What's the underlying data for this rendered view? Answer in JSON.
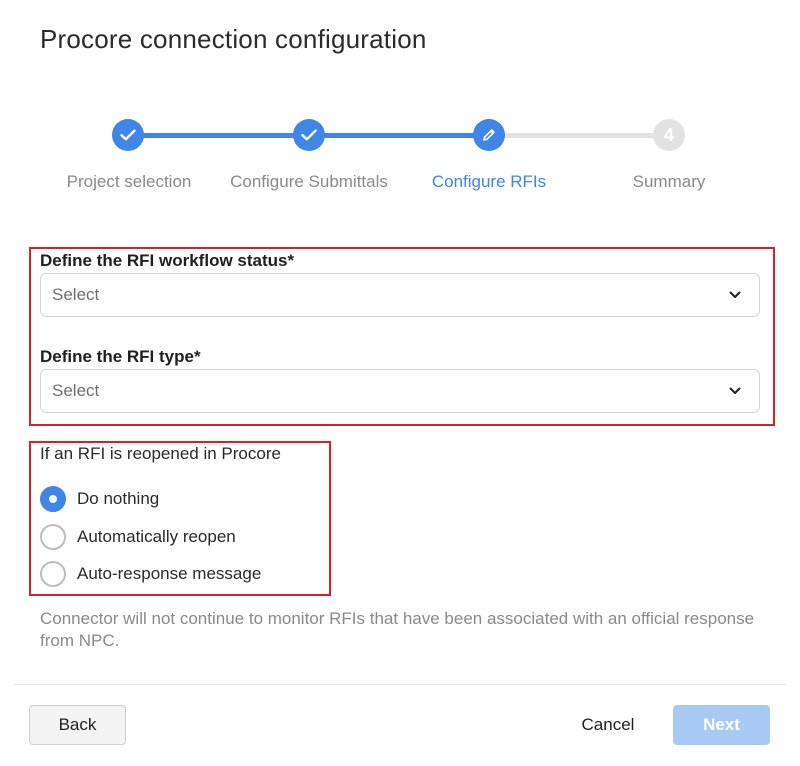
{
  "dialog": {
    "title": "Procore connection configuration"
  },
  "stepper": {
    "steps": [
      {
        "label": "Project selection",
        "state": "done",
        "icon": "check-icon"
      },
      {
        "label": "Configure Submittals",
        "state": "done",
        "icon": "check-icon"
      },
      {
        "label": "Configure RFIs",
        "state": "active",
        "icon": "pencil-icon"
      },
      {
        "label": "Summary",
        "state": "pending",
        "number": "4"
      }
    ]
  },
  "form": {
    "workflow_status": {
      "label": "Define the RFI workflow status*",
      "value": "Select"
    },
    "rfi_type": {
      "label": "Define the RFI type*",
      "value": "Select"
    },
    "reopen": {
      "label": "If an RFI is reopened in Procore",
      "options": [
        {
          "label": "Do nothing",
          "checked": true
        },
        {
          "label": "Automatically reopen",
          "checked": false
        },
        {
          "label": "Auto-response message",
          "checked": false
        }
      ]
    },
    "note": "Connector will not continue to monitor RFIs that have been associated with an official response from NPC."
  },
  "footer": {
    "back_label": "Back",
    "cancel_label": "Cancel",
    "next_label": "Next"
  },
  "colors": {
    "accent": "#3f86e6",
    "highlight": "#d2232a",
    "next_disabled": "#a8c9f3"
  }
}
